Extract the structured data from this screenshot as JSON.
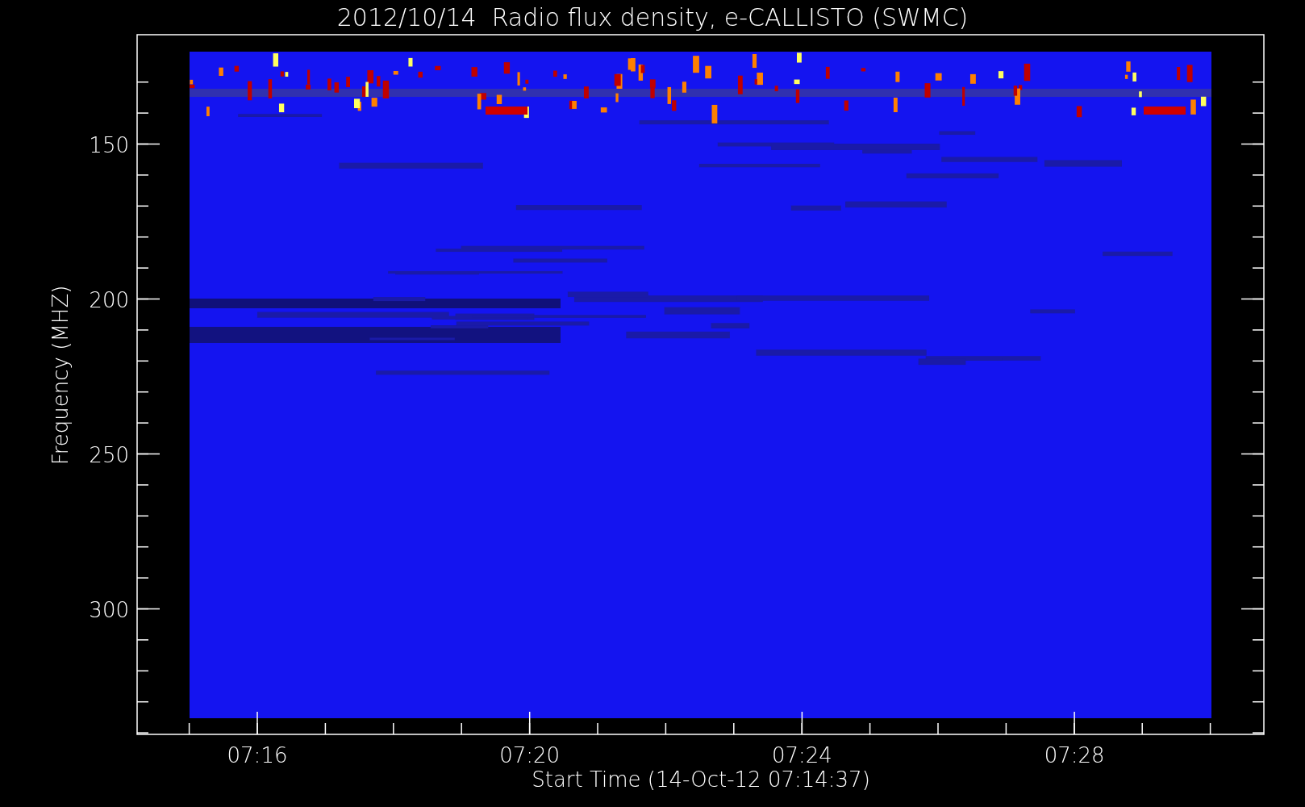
{
  "title": "2012/10/14  Radio flux density, e-CALLISTO (SWMC)",
  "y_axis": {
    "label": "Frequency (MHZ)",
    "ticks": [
      "150",
      "200",
      "250",
      "300"
    ]
  },
  "x_axis": {
    "label": "Start Time (14-Oct-12 07:14:37)",
    "ticks": [
      "07:16",
      "07:20",
      "07:24",
      "07:28"
    ]
  }
}
